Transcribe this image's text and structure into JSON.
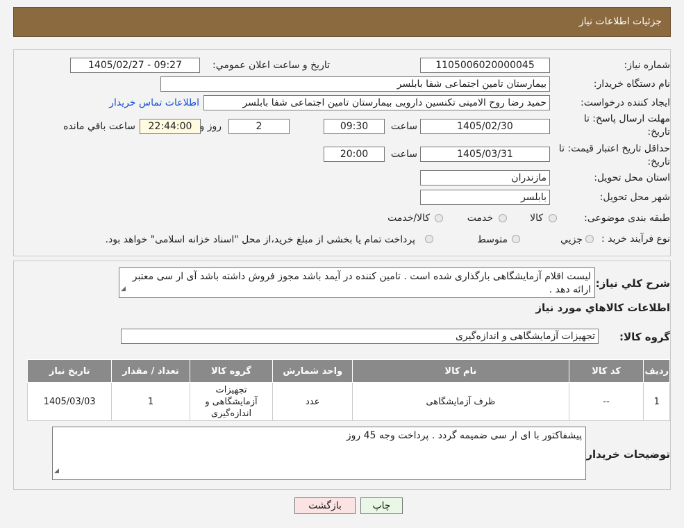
{
  "header": {
    "title": "جزئیات اطلاعات نیاز"
  },
  "form": {
    "need_number_label": "شماره نیاز:",
    "need_number": "1105006020000045",
    "announce_label": "تاریخ و ساعت اعلان عمومي:",
    "announce_value": "1405/02/27 - 09:27",
    "buyer_org_label": "نام دستگاه خریدار:",
    "buyer_org": "بیمارستان تامین اجتماعی شفا بابلسر",
    "creator_label": "ایجاد کننده درخواست:",
    "creator": "حمید رضا روح الامینی تکنسین دارویی بیمارستان تامین اجتماعی شفا بابلسر",
    "contact_link": "اطلاعات تماس خریدار",
    "deadline_label_1": "مهلت ارسال پاسخ: تا",
    "deadline_label_2": "تاریخ:",
    "deadline_date": "1405/02/30",
    "time_label": "ساعت",
    "deadline_time": "09:30",
    "days_value": "2",
    "days_label": "روز و",
    "remaining_value": "22:44:00",
    "remaining_label": "ساعت باقي مانده",
    "validity_label_1": "حداقل تاریخ اعتبار قیمت: تا",
    "validity_label_2": "تاریخ:",
    "validity_date": "1405/03/31",
    "validity_time": "20:00",
    "province_label": "استان محل تحویل:",
    "province": "مازندران",
    "city_label": "شهر محل تحویل:",
    "city": "بابلسر",
    "category_label": "طبقه بندی موضوعی:",
    "cat_goods": "کالا",
    "cat_service": "خدمت",
    "cat_both": "کالا/خدمت",
    "purchase_type_label": "نوع فرآیند خرید :",
    "pt_partial": "جزیي",
    "pt_medium": "متوسط",
    "pt_note": "پرداخت تمام یا بخشی از مبلغ خرید،از محل \"اسناد خزانه اسلامی\" خواهد بود."
  },
  "details": {
    "summary_label": "شرح كلي نياز:",
    "summary": "لیست اقلام آزمایشگاهی بارگذاری شده است . تامین کننده در آیمد باشد مجوز فروش داشته باشد آی ار سی معتبر ارائه دهد .",
    "goods_info_title": "اطلاعات كالاهاي مورد نياز",
    "goods_group_label": "گروه کالا:",
    "goods_group": "تجهیزات آزمایشگاهی و اندازه‌گیری",
    "columns": [
      "ردیف",
      "کد کالا",
      "نام کالا",
      "واحد شمارش",
      "گروه کالا",
      "تعداد / مقدار",
      "تاریخ نیاز"
    ],
    "rows": [
      {
        "row": "1",
        "code": "--",
        "name": "ظرف آزمایشگاهی",
        "unit": "عدد",
        "group": "تجهیزات آزمایشگاهی و اندازه‌گیری",
        "qty": "1",
        "date": "1405/03/03"
      }
    ],
    "buyer_notes_label": "توضیحات خریدار:",
    "buyer_notes": "پیشفاکتور با ای ار سی ضمیمه گردد . پرداخت وجه 45 روز"
  },
  "buttons": {
    "print": "چاپ",
    "back": "بازگشت"
  },
  "colors": {
    "header": "#8b6a3f",
    "link": "#1a4fd0",
    "table_header": "#8a8a8a"
  }
}
